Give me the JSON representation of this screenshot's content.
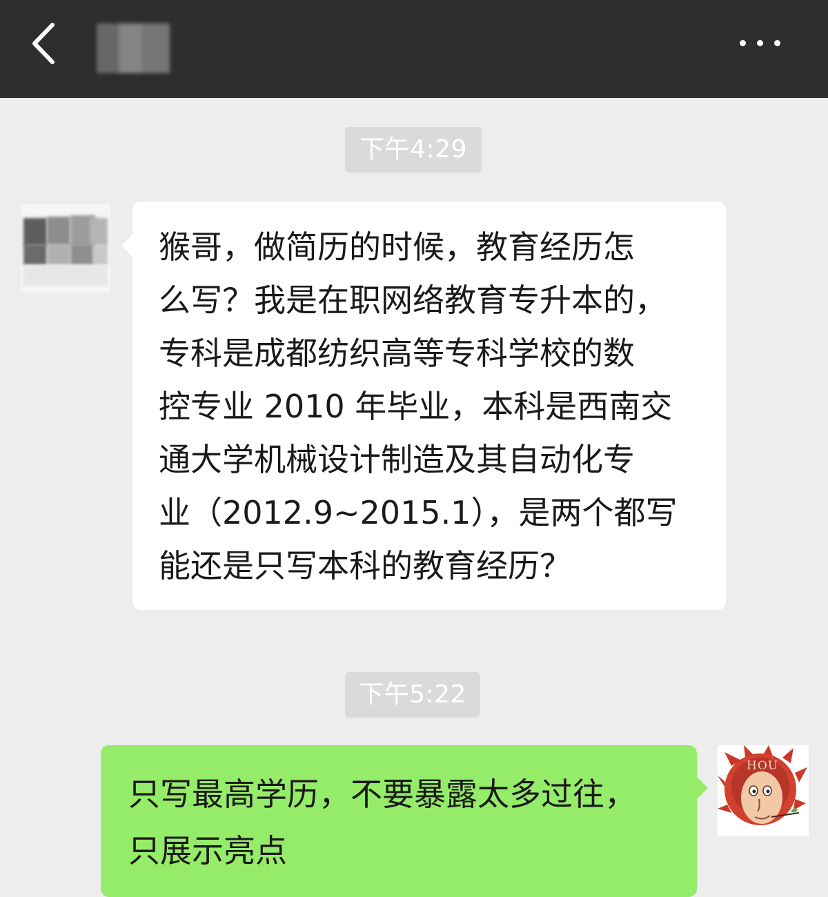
{
  "header": {
    "back_icon": "chevron-left-icon",
    "more_icon": "more-dots-icon"
  },
  "messages": [
    {
      "timestamp": "下午4:29",
      "sender": "contact",
      "lines": [
        "猴哥，做简历的时候，教育经历怎",
        "么写？我是在职网络教育专升本的，",
        "专科是成都纺织高等专科学校的数",
        "控专业 2010 年毕业，本科是西南交",
        "通大学机械设计制造及其自动化专",
        "业（2012.9~2015.1），是两个都写",
        "能还是只写本科的教育经历？"
      ]
    },
    {
      "timestamp": "下午5:22",
      "sender": "self",
      "lines": [
        "只写最高学历，不要暴露太多过往，",
        "只展示亮点"
      ],
      "avatar_text": "HOU"
    }
  ],
  "colors": {
    "topbar": "#2e2e2e",
    "chat_background": "#ededed",
    "incoming_bubble": "#ffffff",
    "outgoing_bubble": "#95ec69",
    "timestamp_bg": "#dadada"
  }
}
